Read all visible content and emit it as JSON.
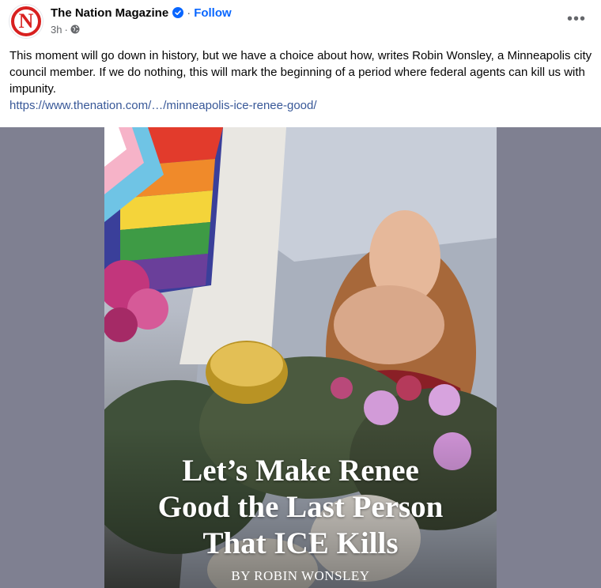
{
  "post": {
    "page_name": "The Nation Magazine",
    "follow_label": "Follow",
    "separator": "·",
    "timestamp": "3h",
    "audience_icon": "globe-icon",
    "more_label": "•••",
    "avatar_letter": "N",
    "caption_text": "This moment will go down in history, but we have a choice about how, writes Robin Wonsley, a Minneapolis city council member. If we do nothing, this will mark the beginning of a period where federal agents can kill us with impunity.",
    "link_text": "https://www.thenation.com/…/minneapolis-ice-renee-good/"
  },
  "media": {
    "headline_lines": [
      "Let’s Make Renee",
      "Good the Last Person",
      "That ICE Kills"
    ],
    "byline": "BY ROBIN WONSLEY"
  },
  "colors": {
    "brand_red": "#d8201f",
    "link_blue": "#0866ff",
    "caption_link": "#385898",
    "muted": "#65676b",
    "media_bg": "#7f8091"
  }
}
